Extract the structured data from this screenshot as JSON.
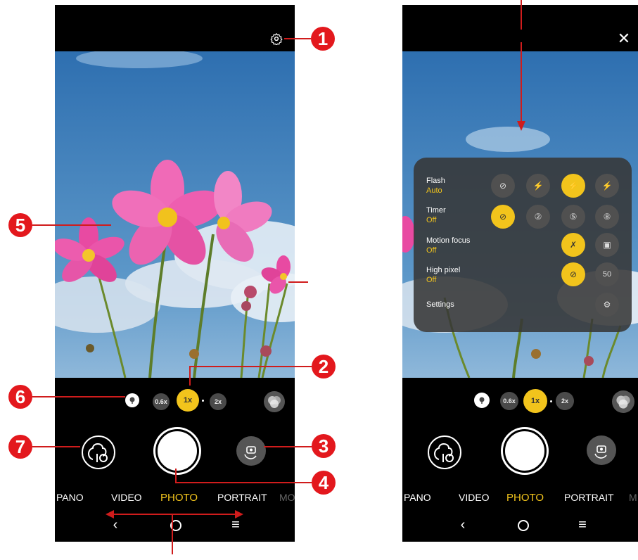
{
  "callouts": [
    "1",
    "2",
    "3",
    "4",
    "5",
    "6",
    "7"
  ],
  "left_screen": {
    "zoom": {
      "z1": "0.6x",
      "z2": "1x",
      "z3": "2x"
    },
    "modes": {
      "pano": "PANO",
      "video": "VIDEO",
      "photo": "PHOTO",
      "portrait": "PORTRAIT",
      "more": "MO"
    }
  },
  "right_screen": {
    "zoom": {
      "z1": "0.6x",
      "z2": "1x",
      "z3": "2x"
    },
    "modes": {
      "pano": "PANO",
      "video": "VIDEO",
      "photo": "PHOTO",
      "portrait": "PORTRAIT",
      "more": "M"
    },
    "panel": {
      "flash": {
        "label": "Flash",
        "value": "Auto"
      },
      "timer": {
        "label": "Timer",
        "value": "Off"
      },
      "motion": {
        "label": "Motion focus",
        "value": "Off"
      },
      "highpixel": {
        "label": "High pixel",
        "value": "Off"
      },
      "settings": {
        "label": "Settings"
      },
      "hp_50": "50"
    }
  },
  "colors": {
    "accent": "#f2c41c",
    "callout": "#e3181d"
  }
}
